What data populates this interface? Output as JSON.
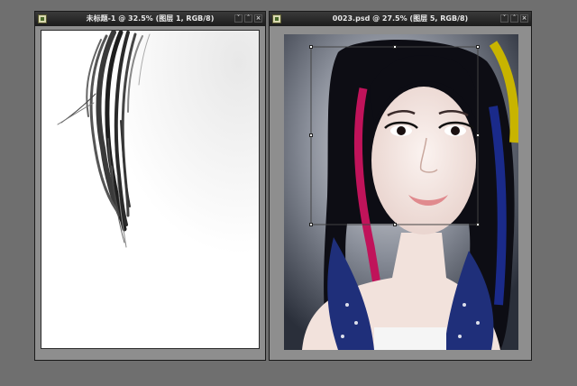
{
  "window1": {
    "title": "未标题-1 @ 32.5% (图层 1, RGB/8)",
    "icon": "photoshop-doc-icon",
    "controls": [
      "minimize-icon",
      "maximize-icon",
      "close-icon"
    ]
  },
  "window2": {
    "title": "0023.psd @ 27.5% (图层 5, RGB/8)",
    "icon": "photoshop-doc-icon",
    "controls": [
      "minimize-icon",
      "maximize-icon",
      "close-icon"
    ]
  },
  "colors": {
    "workspace": "#6f6f6f",
    "titlebar": "#1c1c1c",
    "hair_pink": "#c0135a",
    "hair_yellow": "#c8b400",
    "hair_blue": "#1a2a8a",
    "shirt": "#1f2f7a"
  },
  "glyphs": {
    "minimize": "˅",
    "maximize": "˄",
    "close": "×"
  }
}
